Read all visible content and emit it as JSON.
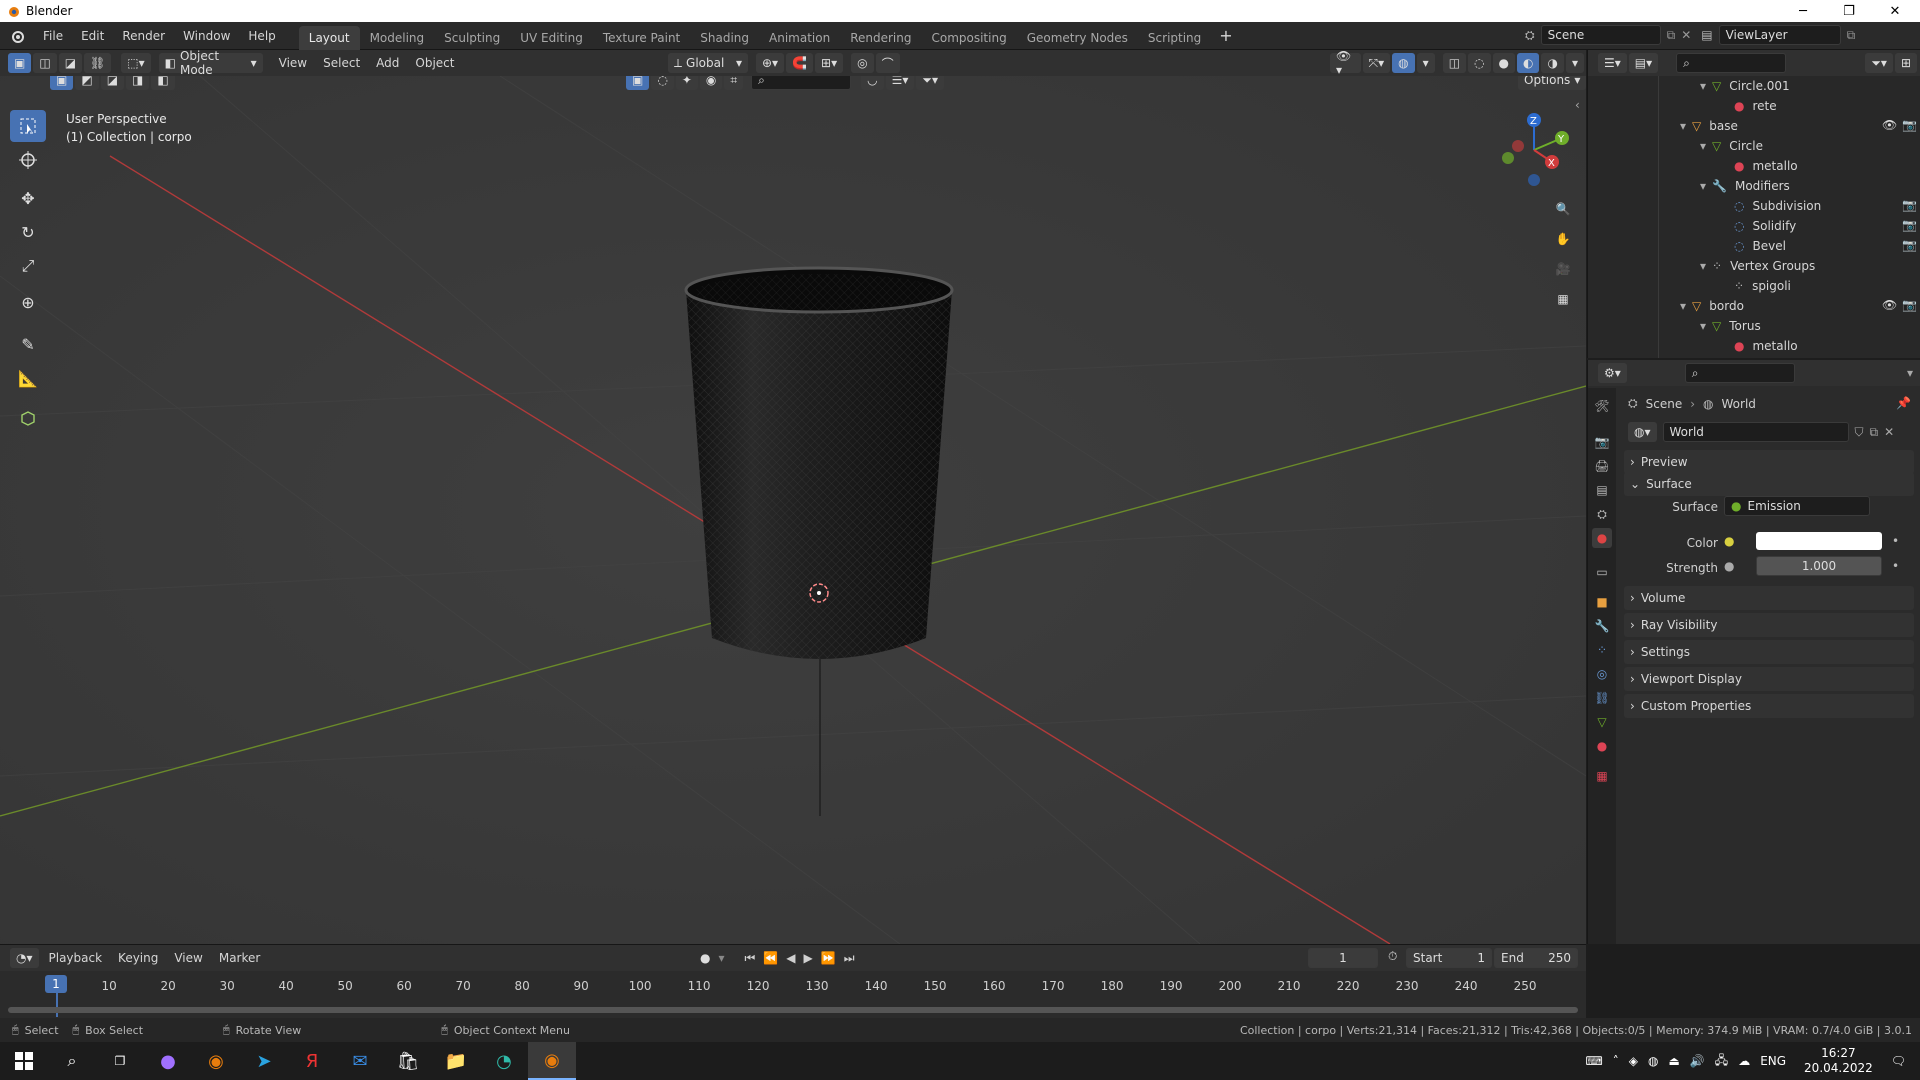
{
  "window": {
    "title": "Blender"
  },
  "menus": [
    "File",
    "Edit",
    "Render",
    "Window",
    "Help"
  ],
  "workspaces": [
    "Layout",
    "Modeling",
    "Sculpting",
    "UV Editing",
    "Texture Paint",
    "Shading",
    "Animation",
    "Rendering",
    "Compositing",
    "Geometry Nodes",
    "Scripting"
  ],
  "active_workspace": "Layout",
  "scene": {
    "name": "Scene",
    "view_layer": "ViewLayer"
  },
  "viewport_header": {
    "mode": "Object Mode",
    "menus": [
      "View",
      "Select",
      "Add",
      "Object"
    ],
    "orientation": "Global",
    "options": "Options"
  },
  "viewport": {
    "perspective": "User Perspective",
    "collection": "(1) Collection | corpo"
  },
  "outliner": {
    "rows": [
      {
        "label": "Circle.001",
        "icon": "mesh-data-icon",
        "indent": 2
      },
      {
        "label": "rete",
        "icon": "material-icon",
        "indent": 3
      },
      {
        "label": "base",
        "icon": "object-icon",
        "indent": 1
      },
      {
        "label": "Circle",
        "icon": "mesh-data-icon",
        "indent": 2
      },
      {
        "label": "metallo",
        "icon": "material-icon",
        "indent": 3
      },
      {
        "label": "Modifiers",
        "icon": "wrench-icon",
        "indent": 2
      },
      {
        "label": "Subdivision",
        "icon": "modifier-icon",
        "indent": 3
      },
      {
        "label": "Solidify",
        "icon": "modifier-icon",
        "indent": 3
      },
      {
        "label": "Bevel",
        "icon": "modifier-icon",
        "indent": 3
      },
      {
        "label": "Vertex Groups",
        "icon": "vertex-groups-icon",
        "indent": 2
      },
      {
        "label": "spigoli",
        "icon": "vertex-group-icon",
        "indent": 3
      },
      {
        "label": "bordo",
        "icon": "object-icon",
        "indent": 1
      },
      {
        "label": "Torus",
        "icon": "mesh-data-icon",
        "indent": 2
      },
      {
        "label": "metallo",
        "icon": "material-icon",
        "indent": 3
      }
    ]
  },
  "properties": {
    "breadcrumb": [
      "Scene",
      "World"
    ],
    "world_name": "World",
    "panels": {
      "preview": "Preview",
      "surface": "Surface",
      "volume": "Volume",
      "ray_visibility": "Ray Visibility",
      "settings": "Settings",
      "viewport_display": "Viewport Display",
      "custom_properties": "Custom Properties"
    },
    "surface_label": "Surface",
    "surface_value": "Emission",
    "color_label": "Color",
    "color_value": "#ffffff",
    "strength_label": "Strength",
    "strength_value": "1.000"
  },
  "timeline": {
    "menus": [
      "Playback",
      "Keying",
      "View",
      "Marker"
    ],
    "current_frame": "1",
    "start_label": "Start",
    "start_value": "1",
    "end_label": "End",
    "end_value": "250",
    "ticks": [
      "10",
      "20",
      "30",
      "40",
      "50",
      "60",
      "70",
      "80",
      "90",
      "100",
      "110",
      "120",
      "130",
      "140",
      "150",
      "160",
      "170",
      "180",
      "190",
      "200",
      "210",
      "220",
      "230",
      "240",
      "250"
    ],
    "marker": "1"
  },
  "statusbar": {
    "select": "Select",
    "box_select": "Box Select",
    "rotate": "Rotate View",
    "context": "Object Context Menu",
    "stats": "Collection | corpo | Verts:21,314 | Faces:21,312 | Tris:42,368 | Objects:0/5 | Memory: 374.9 MiB | VRAM: 0.7/4.0 GiB | 3.0.1"
  },
  "taskbar": {
    "lang": "ENG",
    "time": "16:27",
    "date": "20.04.2022"
  },
  "colors": {
    "accent": "#4772b3",
    "axis_x": "#b03a3a",
    "axis_y": "#6a8a2a"
  }
}
